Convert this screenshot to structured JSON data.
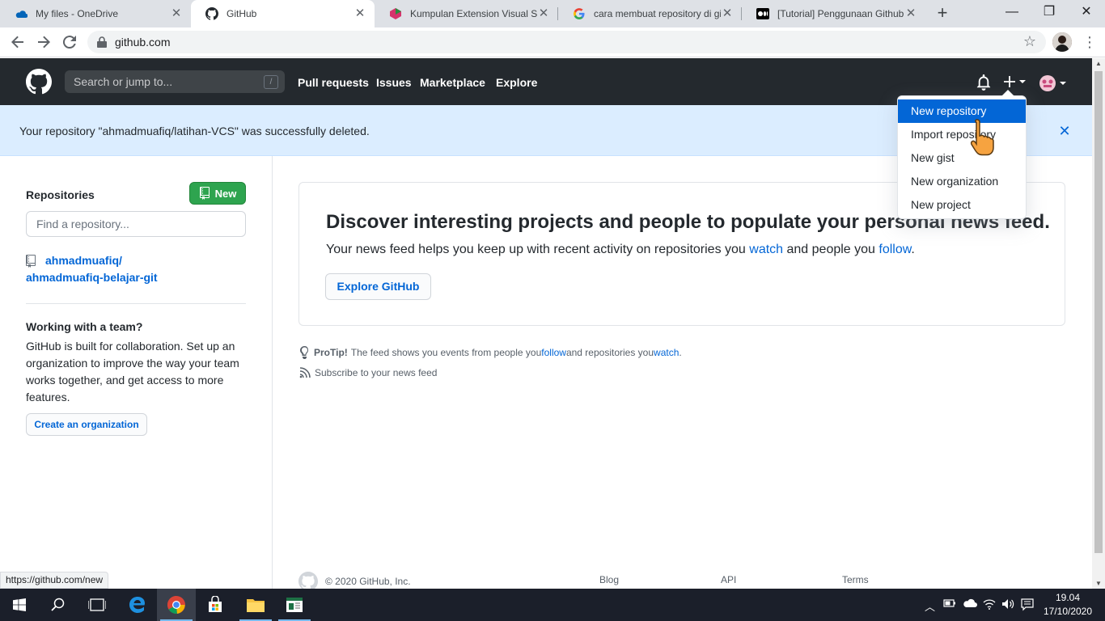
{
  "browser": {
    "tabs": [
      {
        "label": "My files - OneDrive",
        "icon": "onedrive-icon"
      },
      {
        "label": "GitHub",
        "icon": "github-icon"
      },
      {
        "label": "Kumpulan Extension Visual Stu",
        "icon": "site-icon"
      },
      {
        "label": "cara membuat repository di gi",
        "icon": "google-icon"
      },
      {
        "label": "[Tutorial] Penggunaan Github",
        "icon": "medium-icon"
      }
    ],
    "new_tab": "+",
    "url": "github.com",
    "status_url": "https://github.com/new"
  },
  "header": {
    "search_placeholder": "Search or jump to...",
    "search_shortcut": "/",
    "nav": [
      "Pull requests",
      "Issues",
      "Marketplace",
      "Explore"
    ]
  },
  "flash": {
    "message": "Your repository \"ahmadmuafiq/latihan-VCS\" was successfully deleted."
  },
  "sidebar": {
    "repos_title": "Repositories",
    "new_button": "New",
    "find_placeholder": "Find a repository...",
    "repo_owner": "ahmadmuafiq/",
    "repo_name": "ahmadmuafiq-belajar-git",
    "team_title": "Working with a team?",
    "team_text": "GitHub is built for collaboration. Set up an organization to improve the way your team works together, and get access to more features.",
    "create_org": "Create an organization"
  },
  "main": {
    "discover_title": "Discover interesting projects and people to populate your personal news feed.",
    "discover_text_1": "Your news feed helps you keep up with recent activity on repositories you ",
    "discover_link_watch": "watch",
    "discover_text_2": " and people you ",
    "discover_link_follow": "follow",
    "discover_text_3": ".",
    "explore_button": "Explore GitHub",
    "protip_label": "ProTip!",
    "protip_text_1": " The feed shows you events from people you ",
    "protip_follow": "follow",
    "protip_text_2": " and repositories you ",
    "protip_watch": "watch",
    "protip_text_3": ".",
    "subscribe": "Subscribe to your news feed"
  },
  "footer": {
    "copyright": "© 2020 GitHub, Inc.",
    "links": [
      "Blog",
      "API",
      "Terms"
    ]
  },
  "dropdown": {
    "items": [
      "New repository",
      "Import repository",
      "New gist",
      "New organization",
      "New project"
    ],
    "highlighted": 0
  },
  "taskbar": {
    "time": "19.04",
    "date": "17/10/2020"
  },
  "colors": {
    "github_header": "#24292e",
    "flash_bg": "#dbedff",
    "new_button": "#2ea44f",
    "link": "#0366d6",
    "dropdown_highlight": "#0366d6"
  }
}
